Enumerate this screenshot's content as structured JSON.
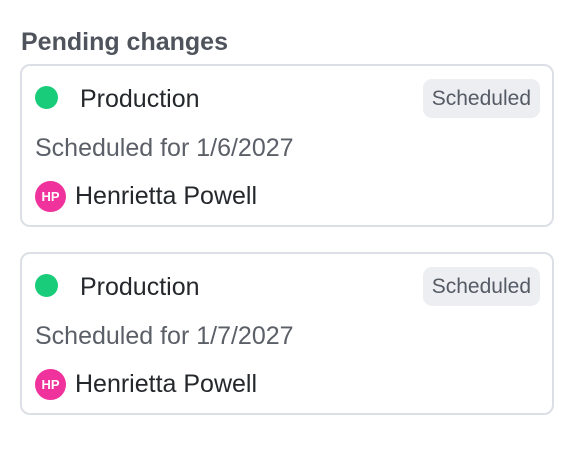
{
  "section": {
    "title": "Pending changes"
  },
  "colors": {
    "status_green": "#18cc7a",
    "avatar_pink": "#f0339c",
    "badge_background": "#eceef2"
  },
  "changes": [
    {
      "environment": "Production",
      "status_badge": "Scheduled",
      "schedule_text": "Scheduled for 1/6/2027",
      "owner": {
        "initials": "HP",
        "name": "Henrietta Powell"
      }
    },
    {
      "environment": "Production",
      "status_badge": "Scheduled",
      "schedule_text": "Scheduled for 1/7/2027",
      "owner": {
        "initials": "HP",
        "name": "Henrietta Powell"
      }
    }
  ]
}
